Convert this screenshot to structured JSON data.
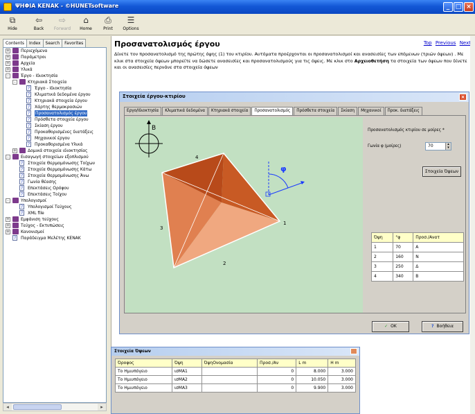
{
  "window": {
    "title": "ΨΗΦΙΑ ΚΕΝΑΚ - ©HUNETsoftware"
  },
  "toolbar": {
    "hide": "Hide",
    "back": "Back",
    "forward": "Forward",
    "home": "Home",
    "print": "Print",
    "options": "Options"
  },
  "nav": {
    "tabs": [
      "Contents",
      "Index",
      "Search",
      "Favorites"
    ],
    "tree": [
      {
        "label": "Περιεχόμενα",
        "level": 0,
        "type": "book",
        "exp": "+"
      },
      {
        "label": "Παράμετροι",
        "level": 0,
        "type": "book",
        "exp": "+"
      },
      {
        "label": "Αρχεία",
        "level": 0,
        "type": "book",
        "exp": "+"
      },
      {
        "label": "Υλικά",
        "level": 0,
        "type": "book",
        "exp": "+"
      },
      {
        "label": "Έργο - Ιδιοκτησία",
        "level": 0,
        "type": "book",
        "exp": "-"
      },
      {
        "label": "Κτηριακά Στοιχεία",
        "level": 1,
        "type": "book",
        "exp": "-"
      },
      {
        "label": "Έργο - Ιδιοκτησία",
        "level": 2,
        "type": "page"
      },
      {
        "label": "Κλιματικά δεδομένα έργου",
        "level": 2,
        "type": "page"
      },
      {
        "label": "Κτηριακά στοιχεία έργου",
        "level": 2,
        "type": "page"
      },
      {
        "label": "Χάρτης θερμοκρασιών",
        "level": 2,
        "type": "page"
      },
      {
        "label": "Προσανατολισμός έργου",
        "level": 2,
        "type": "page",
        "selected": true
      },
      {
        "label": "Πρόσθετα στοιχεία έργου",
        "level": 2,
        "type": "page"
      },
      {
        "label": "Σκίαση έργου",
        "level": 2,
        "type": "page"
      },
      {
        "label": "Προκαθορισμένες διατάξεις",
        "level": 2,
        "type": "page"
      },
      {
        "label": "Μηχανικοί έργου",
        "level": 2,
        "type": "page"
      },
      {
        "label": "Προκαθορισμένα Υλικά",
        "level": 2,
        "type": "page"
      },
      {
        "label": "Δομικά στοιχεία ιδιοκτησίας",
        "level": 1,
        "type": "book",
        "exp": "+"
      },
      {
        "label": "Εισαγωγή στοιχείων εξοπλισμού",
        "level": 0,
        "type": "book",
        "exp": "-"
      },
      {
        "label": "Στοιχεία Θερμομόνωσης Τοίχων",
        "level": 1,
        "type": "page"
      },
      {
        "label": "Στοιχεία Θερμομόνωσης Κάτω",
        "level": 1,
        "type": "page"
      },
      {
        "label": "Στοιχεία Θερμομόνωσης Άνω",
        "level": 1,
        "type": "page"
      },
      {
        "label": "Γωνία θέασης",
        "level": 1,
        "type": "page"
      },
      {
        "label": "Επεκτάσεις Ορόφου",
        "level": 1,
        "type": "page"
      },
      {
        "label": "Επεκτάσεις Τοίχου",
        "level": 1,
        "type": "page"
      },
      {
        "label": "Υπολογισμοί",
        "level": 0,
        "type": "book",
        "exp": "-"
      },
      {
        "label": "Υπολογισμοί Τεύχους",
        "level": 1,
        "type": "page"
      },
      {
        "label": "XML file",
        "level": 1,
        "type": "page"
      },
      {
        "label": "Εμφάνιση τεύχους",
        "level": 0,
        "type": "book",
        "exp": "+"
      },
      {
        "label": "Τεύχος - Εκτυπώσεις",
        "level": 0,
        "type": "book",
        "exp": "+"
      },
      {
        "label": "Κανονισμοί",
        "level": 0,
        "type": "book",
        "exp": "+"
      },
      {
        "label": "Παράδειγμα Μελέτης ΚΕΝΑΚ",
        "level": 0,
        "type": "page"
      }
    ]
  },
  "content": {
    "title": "Προσανατολισμός έργου",
    "links": {
      "top": "Top",
      "previous": "Previous",
      "next": "Next"
    },
    "intro_1": "Δίνετε τον προσανατολισμό της πρώτης όψης (1) του κτιρίου. Αυτόματα προέρχονται οι προσανατολισμοί και ανασεισίες των επόμενων (τριών όψεων) . Με κλικ στα στοιχεία όψεων μπορείτε να δώσετε ανασεισίες και προσανατολισμούς για τις όψεις. Με κλικ στο ",
    "intro_bold": "Αρχειοθετήση",
    "intro_2": " τα στοιχεία των όψεων που δίνετε και οι ανασεισίες περνάνε στα στοιχεία όψεων"
  },
  "dialog": {
    "title": "Στοιχεία έργου-κτιρίου",
    "tabs": [
      "Εργο/Ιδιοκτησία",
      "Κλιματικά δεδομένα",
      "Κτηριακά στοιχεία",
      "Προσανατολισμός",
      "Πρόσθετα στοιχεία",
      "Σκίαση",
      "Μηχανικοί",
      "Προκ. διατάξεις"
    ],
    "orientation_label": "Προσανατολισμός κτιρίου σε μοίρες *",
    "angle_label": "Γωνία φ (μοίρες)",
    "angle_value": "70",
    "sides_button": "Στοιχεία Όψεων",
    "canvas": {
      "north": "B",
      "phi": "φ",
      "side1": "1",
      "side2": "2",
      "side3": "3",
      "side4": "4"
    },
    "table": {
      "headers": [
        "Όψη",
        "°φ",
        "Προσ./Ανατ"
      ],
      "rows": [
        [
          "1",
          "70",
          "Α"
        ],
        [
          "2",
          "160",
          "Ν"
        ],
        [
          "3",
          "250",
          "Δ"
        ],
        [
          "4",
          "340",
          "Β"
        ]
      ]
    },
    "ok": "OK",
    "help": "Βοήθεια",
    "colors": {
      "face_dark": "#b84a1a",
      "face_mid": "#e08050",
      "face_light": "#f0a880",
      "canvas": "#c2e0c2"
    }
  },
  "sides": {
    "title": "Στοιχεία Όψεων",
    "headers": [
      "Όροφος",
      "Όψη",
      "ΌψηΟνομασία",
      "Προσ./Αν",
      "L m",
      "H m"
    ],
    "rows": [
      [
        "Το Ημιυπόγειο",
        "ισΜΑ1",
        "",
        "0",
        "8.000",
        "3.000"
      ],
      [
        "Το Ημιυπόγειο",
        "ισΜΑ2",
        "",
        "0",
        "10.050",
        "3.000"
      ],
      [
        "Το Ημιυπόγειο",
        "ισΜΑ3",
        "",
        "0",
        "9.900",
        "3.000"
      ]
    ]
  }
}
